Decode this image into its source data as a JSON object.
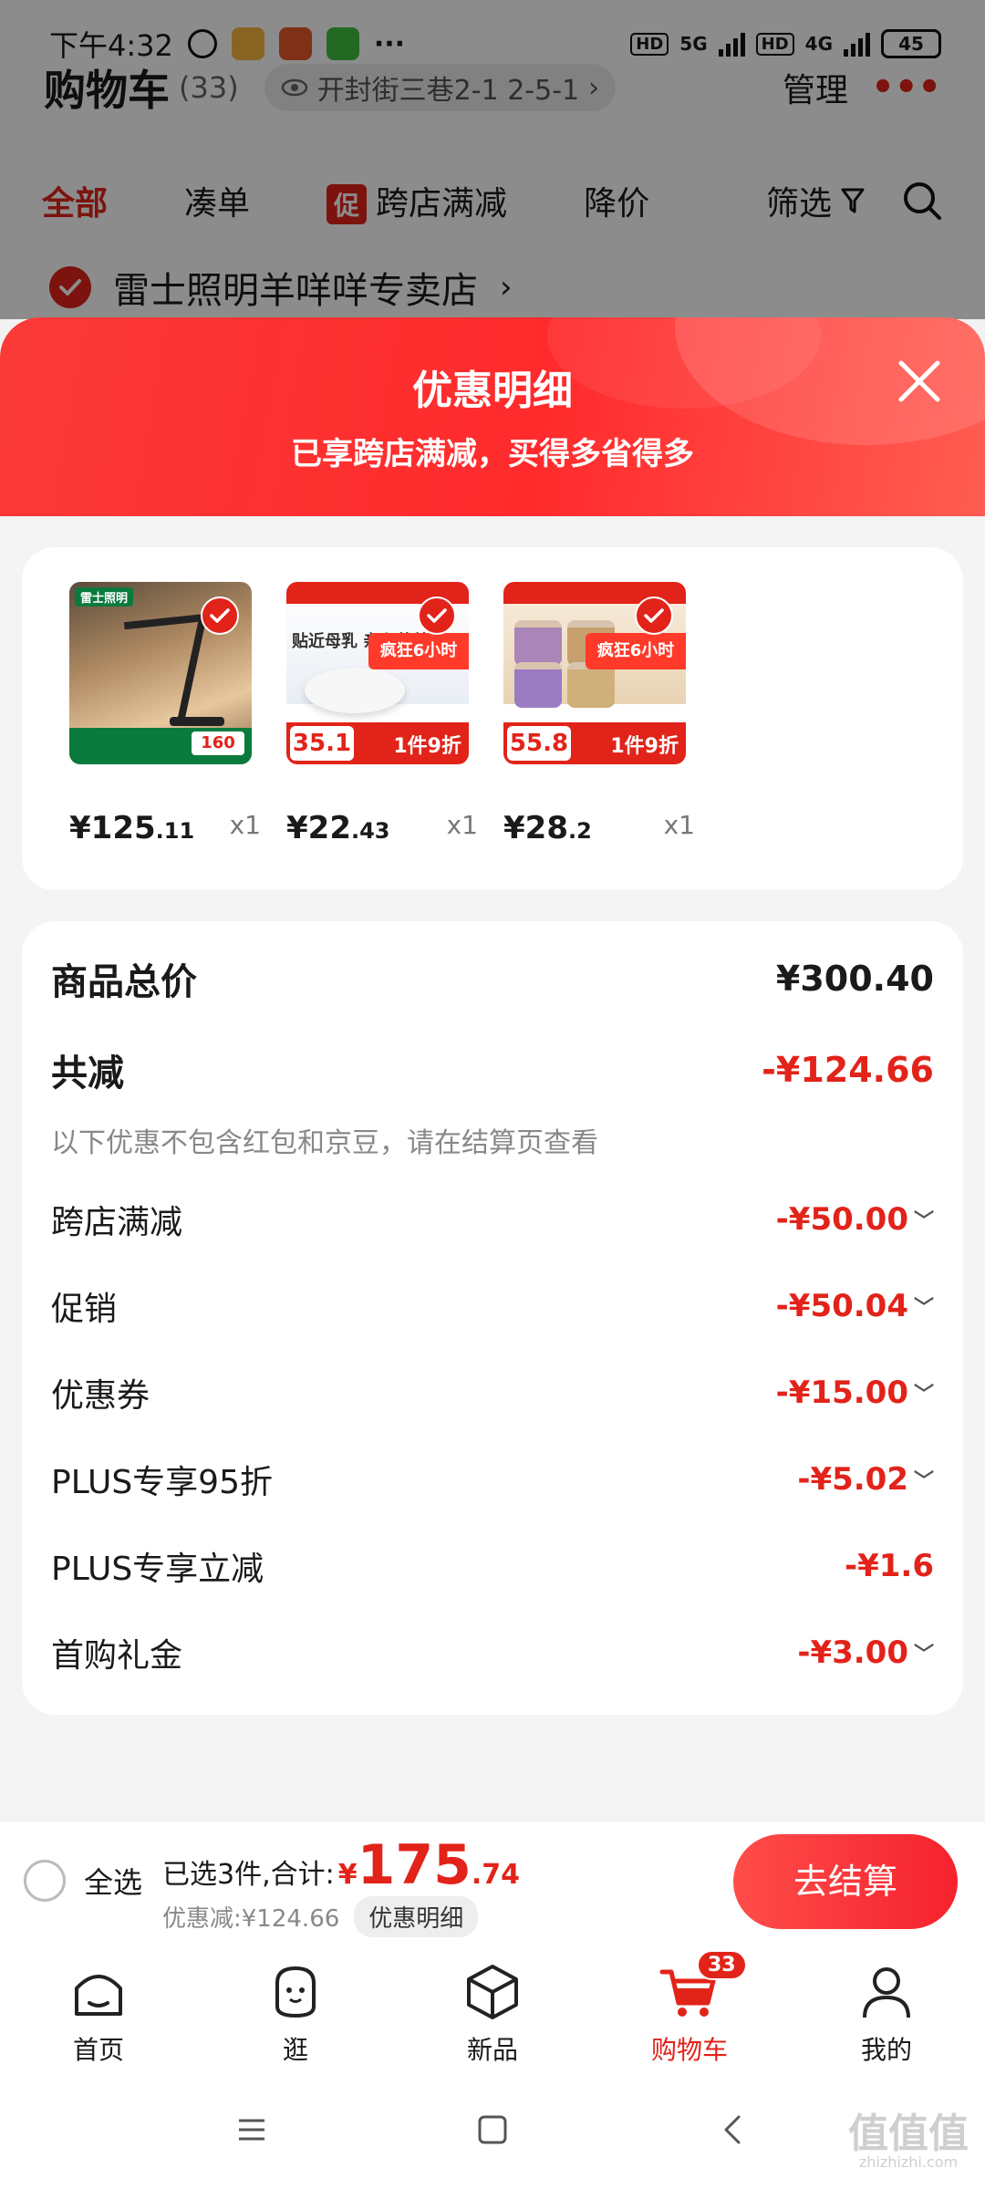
{
  "status": {
    "time": "下午4:32",
    "network1": "5G",
    "network2": "4G",
    "battery": "45"
  },
  "cart": {
    "title": "购物车",
    "count": "(33)",
    "address": "开封街三巷2-1 2-5-1",
    "manage": "管理"
  },
  "tabs": [
    {
      "label": "全部"
    },
    {
      "label": "凑单"
    },
    {
      "label": "跨店满减",
      "tag": "促"
    },
    {
      "label": "降价"
    },
    {
      "label": "筛选"
    }
  ],
  "store": {
    "name": "雷士照明羊咩咩专卖店"
  },
  "sheet": {
    "title": "优惠明细",
    "subtitle": "已享跨店满减，买得多省得多"
  },
  "products": [
    {
      "price_int": "¥125",
      "price_dec": ".11",
      "qty": "x1",
      "thumb_brand": "雷士照明",
      "thumb_price": "160"
    },
    {
      "price_int": "¥22",
      "price_dec": ".43",
      "qty": "x1",
      "thumb_text": "贴近母乳 亲和营养",
      "thumb_promo": "疯狂6小时",
      "thumb_price": "35.1",
      "thumb_discount": "1件9折"
    },
    {
      "price_int": "¥28",
      "price_dec": ".2",
      "qty": "x1",
      "thumb_promo": "疯狂6小时",
      "thumb_price": "55.8",
      "thumb_discount": "1件9折"
    }
  ],
  "totals": {
    "goods_total_label": "商品总价",
    "goods_total_value": "¥300.40",
    "reduced_label": "共减",
    "reduced_value": "-¥124.66",
    "note": "以下优惠不包含红包和京豆，请在结算页查看",
    "items": [
      {
        "label": "跨店满减",
        "value": "-¥50.00",
        "expandable": true
      },
      {
        "label": "促销",
        "value": "-¥50.04",
        "expandable": true
      },
      {
        "label": "优惠券",
        "value": "-¥15.00",
        "expandable": true
      },
      {
        "label": "PLUS专享95折",
        "value": "-¥5.02",
        "expandable": true
      },
      {
        "label": "PLUS专享立减",
        "value": "-¥1.6",
        "expandable": false
      },
      {
        "label": "首购礼金",
        "value": "-¥3.00",
        "expandable": true
      }
    ]
  },
  "checkout": {
    "select_all": "全选",
    "selected_text": "已选3件,合计:",
    "total_yen": "¥",
    "total_int": "175",
    "total_dec": ".74",
    "discount_text": "优惠减:¥124.66",
    "detail_button": "优惠明细",
    "checkout_button": "去结算"
  },
  "tabbar": [
    {
      "label": "首页",
      "icon": "home-icon"
    },
    {
      "label": "逛",
      "icon": "explore-icon"
    },
    {
      "label": "新品",
      "icon": "new-products-icon"
    },
    {
      "label": "购物车",
      "icon": "cart-icon",
      "badge": "33",
      "active": true
    },
    {
      "label": "我的",
      "icon": "profile-icon"
    }
  ],
  "watermark": {
    "text": "值值值",
    "sub": "zhizhizhi.com"
  },
  "colors": {
    "accent": "#e2231a",
    "sheet_header": "#fa3a37"
  }
}
